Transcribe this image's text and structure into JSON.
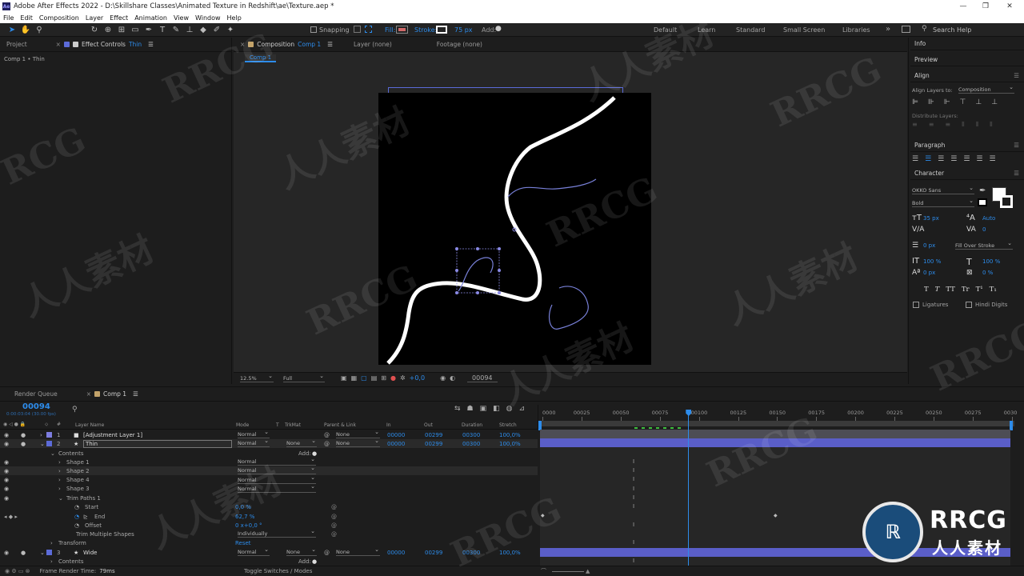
{
  "titlebar": {
    "app_title": "Adobe After Effects 2022 - D:\\Skillshare Classes\\Animated Texture in Redshift\\ae\\Texture.aep *",
    "logo": "Ae",
    "minimize": "—",
    "maximize": "❐",
    "close": "✕"
  },
  "menu": [
    "File",
    "Edit",
    "Composition",
    "Layer",
    "Effect",
    "Animation",
    "View",
    "Window",
    "Help"
  ],
  "toolbar": {
    "snapping": "Snapping",
    "fill": "Fill:",
    "stroke": "Stroke:",
    "stroke_width": "75 px",
    "add": "Add:",
    "workspaces": [
      "Default",
      "Learn",
      "Standard",
      "Small Screen",
      "Libraries"
    ],
    "more": "»",
    "search_placeholder": "Search Help",
    "fill_color": "#d26a6a",
    "stroke_color": "#ffffff",
    "tool_icons": [
      "selection-tool-icon",
      "hand-tool-icon",
      "zoom-tool-icon",
      "rotate-tool-icon",
      "camera-orbit-icon",
      "pan-behind-icon",
      "rectangle-tool-icon",
      "pen-tool-icon",
      "type-tool-icon",
      "brush-tool-icon",
      "clone-stamp-icon",
      "eraser-tool-icon",
      "roto-brush-icon",
      "puppet-pin-icon"
    ]
  },
  "left_panel": {
    "tab_project": "Project",
    "tab_effect_controls_prefix": "Effect Controls",
    "tab_effect_controls_layer": "Thin",
    "breadcrumb": "Comp 1 • Thin"
  },
  "viewer": {
    "tab_composition_prefix": "Composition",
    "tab_composition_name": "Comp 1",
    "tab_layer": "Layer (none)",
    "tab_footage": "Footage (none)",
    "comp_chip": "Comp 1",
    "zoom": "12.5%",
    "resolution": "Full",
    "exposure": "+0,0",
    "timecode": "00094"
  },
  "right_panel": {
    "info": "Info",
    "preview": "Preview",
    "align": "Align",
    "align_layers_to_label": "Align Layers to:",
    "align_layers_to_value": "Composition",
    "distribute_layers": "Distribute Layers:",
    "paragraph": "Paragraph",
    "character": "Character",
    "font_family": "OKKO Sans",
    "font_style": "Bold",
    "font_size": "35 px",
    "leading": "Auto",
    "kerning": "",
    "tracking": "0",
    "stroke_width": "0 px",
    "stroke_mode": "Fill Over Stroke",
    "vertical_scale": "100 %",
    "horizontal_scale": "100 %",
    "baseline_shift": "0 px",
    "tsume": "0 %",
    "ligatures": "Ligatures",
    "hindi_digits": "Hindi Digits",
    "text_style_buttons": [
      "T",
      "T",
      "TT",
      "Tr",
      "T¹",
      "T₁"
    ]
  },
  "timeline": {
    "tab_render_queue": "Render Queue",
    "tab_comp": "Comp 1",
    "current_frame": "00094",
    "current_time": "0:00:03:04 (30.00 fps)",
    "search_placeholder": "",
    "columns": {
      "layer_name": "Layer Name",
      "mode": "Mode",
      "t": "T",
      "trkmat": "TrkMat",
      "parent": "Parent & Link",
      "in": "In",
      "out": "Out",
      "duration": "Duration",
      "stretch": "Stretch"
    },
    "layers": [
      {
        "num": "1",
        "name": "[Adjustment Layer 1]",
        "mode": "Normal",
        "trkmat": "",
        "parent": "None",
        "in": "00000",
        "out": "00299",
        "duration": "00300",
        "stretch": "100,0%"
      },
      {
        "num": "2",
        "name": "Thin",
        "mode": "Normal",
        "trkmat": "None",
        "parent": "None",
        "in": "00000",
        "out": "00299",
        "duration": "00300",
        "stretch": "100,0%"
      },
      {
        "num": "3",
        "name": "Wide",
        "mode": "Normal",
        "trkmat": "None",
        "parent": "None",
        "in": "00000",
        "out": "00299",
        "duration": "00300",
        "stretch": "100,0%"
      }
    ],
    "contents": "Contents",
    "add": "Add:",
    "shapes": [
      {
        "name": "Shape 1",
        "mode": "Normal"
      },
      {
        "name": "Shape 2",
        "mode": "Normal"
      },
      {
        "name": "Shape 4",
        "mode": "Normal"
      },
      {
        "name": "Shape 3",
        "mode": "Normal"
      }
    ],
    "trim_paths": "Trim Paths 1",
    "start_label": "Start",
    "start_value": "0,0 %",
    "end_label": "End",
    "end_value": "62,7 %",
    "offset_label": "Offset",
    "offset_value": "0 x+0,0 °",
    "trim_multiple_label": "Trim Multiple Shapes",
    "trim_multiple_value": "Individually",
    "transform": "Transform",
    "reset": "Reset",
    "ruler": [
      "0000",
      "00025",
      "00050",
      "00075",
      "00100",
      "00125",
      "00150",
      "00175",
      "00200",
      "00225",
      "00250",
      "00275",
      "0030"
    ],
    "playhead_frame": 94,
    "duration_frames": 300,
    "footer_render_time_label": "Frame Render Time:",
    "footer_render_time": "79ms",
    "footer_toggle": "Toggle Switches / Modes"
  },
  "watermark": {
    "text_en": "RRCG",
    "text_cn": "人人素材"
  }
}
